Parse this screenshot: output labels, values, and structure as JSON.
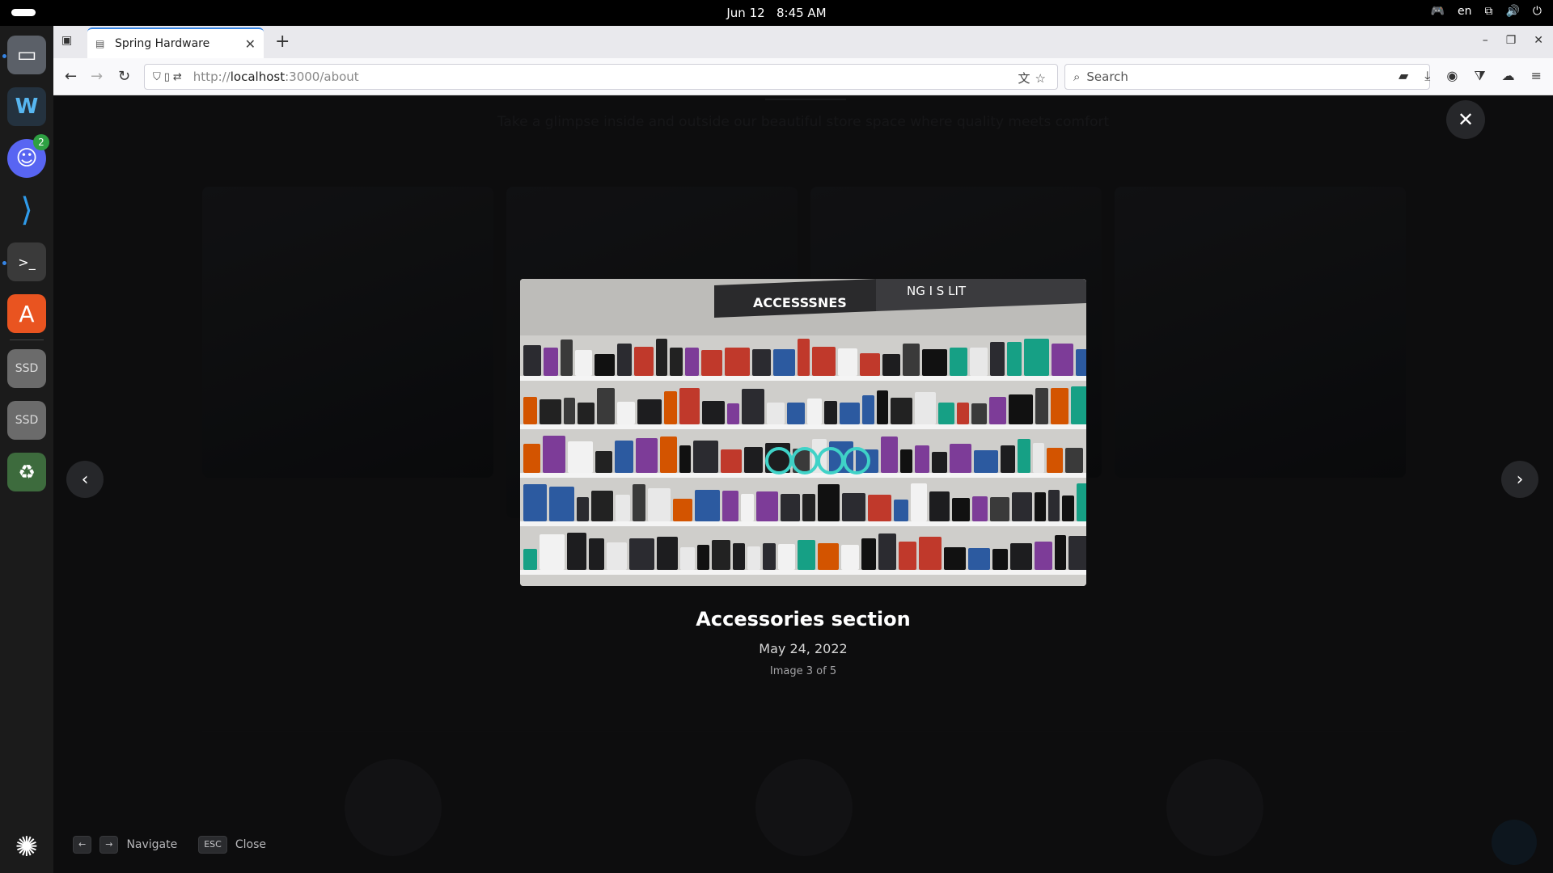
{
  "system": {
    "date": "Jun 12",
    "time": "8:45 AM",
    "language": "en"
  },
  "dock": {
    "discord_badge": "2",
    "ssd_label_1": "SSD",
    "ssd_label_2": "SSD"
  },
  "browser": {
    "tab_title": "Spring Hardware",
    "url_prefix": "http://",
    "url_host": "localhost",
    "url_rest": ":3000/about",
    "search_placeholder": "Search"
  },
  "page": {
    "subtitle": "Take a glimpse inside and outside our beautiful store space where quality meets comfort"
  },
  "lightbox": {
    "title": "Accessories section",
    "date": "May 24, 2022",
    "counter": "Image 3 of 5",
    "sign_left": "ACCESSSNES",
    "sign_right": "NG I S LIT"
  },
  "hints": {
    "key_left": "←",
    "key_right": "→",
    "navigate_label": "Navigate",
    "key_esc": "ESC",
    "close_label": "Close"
  }
}
